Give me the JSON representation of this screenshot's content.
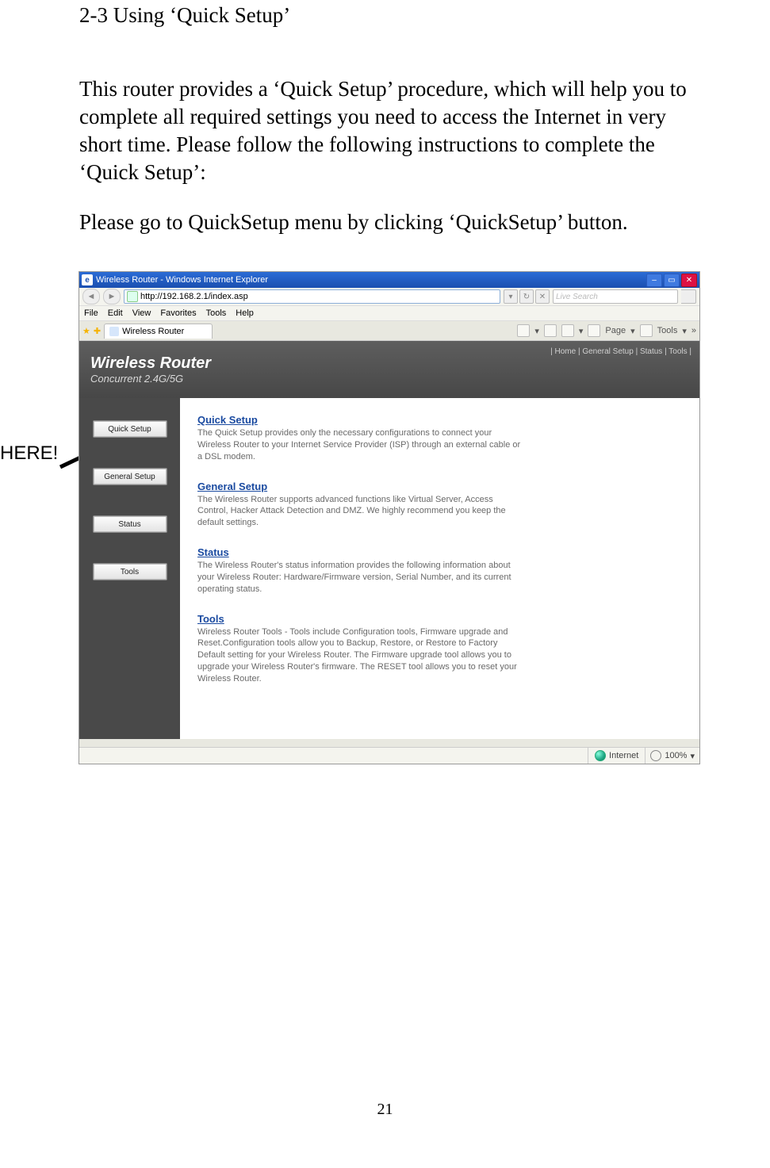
{
  "doc": {
    "heading": "2-3 Using ‘Quick Setup’",
    "para1": "This router provides a ‘Quick Setup’ procedure, which will help you to complete all required settings you need to access the Internet in very short time. Please follow the following instructions to complete the ‘Quick Setup’:",
    "para2": "Please go to QuickSetup menu by clicking ‘QuickSetup’ button.",
    "here": "HERE!",
    "page_number": "21"
  },
  "browser": {
    "title": "Wireless Router - Windows Internet Explorer",
    "address": "http://192.168.2.1/index.asp",
    "search_placeholder": "Live Search",
    "menus": [
      "File",
      "Edit",
      "View",
      "Favorites",
      "Tools",
      "Help"
    ],
    "tab_label": "Wireless Router",
    "toolbar": {
      "page": "Page",
      "tools": "Tools"
    },
    "status_net": "Internet",
    "status_zoom": "100%"
  },
  "router": {
    "title1": "Wireless Router",
    "title2": "Concurrent 2.4G/5G",
    "header_links": "| Home | General Setup | Status | Tools |",
    "sidebar": [
      "Quick Setup",
      "General Setup",
      "Status",
      "Tools"
    ],
    "sections": [
      {
        "title": "Quick Setup",
        "desc": "The Quick Setup provides only the necessary configurations to connect your Wireless Router to your Internet Service Provider (ISP) through an external cable or a DSL modem."
      },
      {
        "title": "General Setup",
        "desc": "The Wireless Router supports advanced functions like Virtual Server, Access Control, Hacker Attack Detection and DMZ. We highly recommend you keep the default settings."
      },
      {
        "title": "Status",
        "desc": "The Wireless Router's status information provides the following information about your Wireless Router: Hardware/Firmware version, Serial Number, and its current operating status."
      },
      {
        "title": "Tools",
        "desc": "Wireless Router Tools - Tools include Configuration tools, Firmware upgrade and Reset.Configuration tools allow you to Backup, Restore, or Restore to Factory Default setting for your Wireless Router. The Firmware upgrade tool allows you to upgrade your Wireless Router's firmware. The RESET tool allows you to reset your Wireless Router."
      }
    ]
  }
}
